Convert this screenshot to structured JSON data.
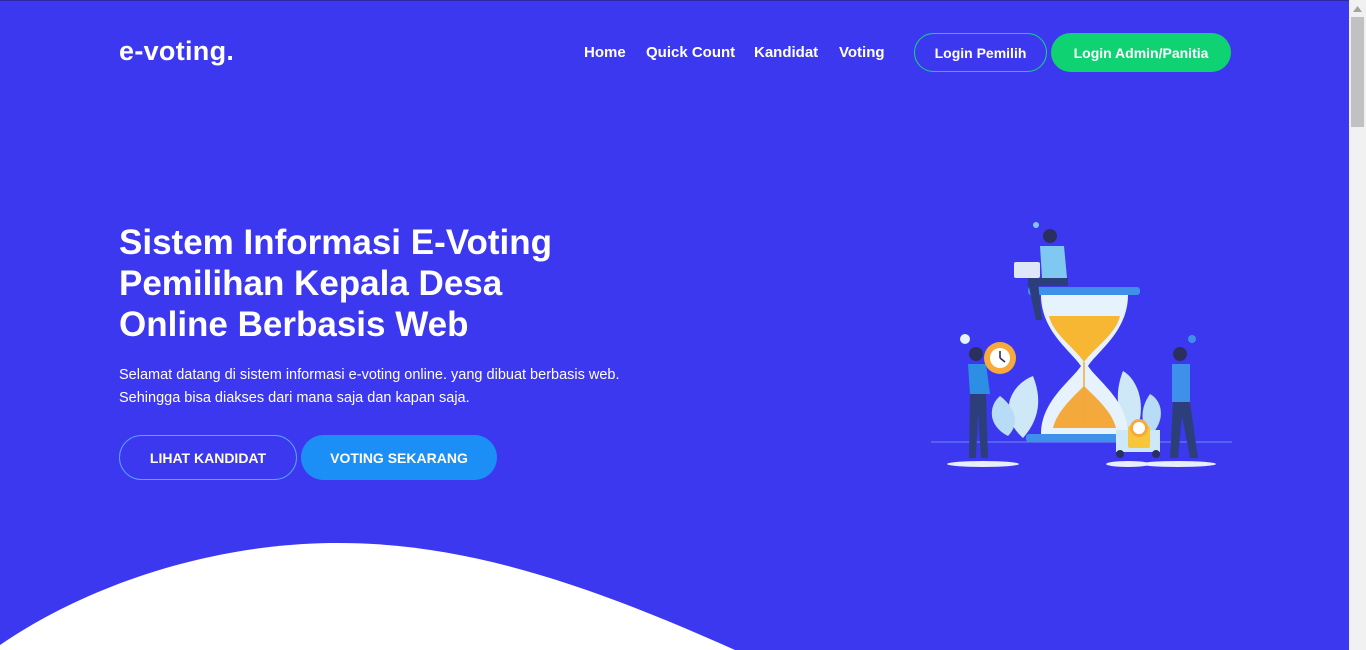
{
  "brand": {
    "logo_text": "e-voting."
  },
  "nav": {
    "links": [
      {
        "label": "Home"
      },
      {
        "label": "Quick Count"
      },
      {
        "label": "Kandidat"
      },
      {
        "label": "Voting"
      }
    ],
    "login_voter_label": "Login Pemilih",
    "login_admin_label": "Login Admin/Panitia"
  },
  "hero": {
    "title_lines": [
      "Sistem Informasi E-Voting",
      "Pemilihan Kepala Desa",
      "Online Berbasis Web"
    ],
    "subtitle_lines": [
      "Selamat datang di sistem informasi e-voting online. yang dibuat berbasis web.",
      "Sehingga bisa diakses dari mana saja dan kapan saja."
    ],
    "btn_view_candidates": "LIHAT KANDIDAT",
    "btn_vote_now": "VOTING SEKARANG"
  },
  "colors": {
    "hero_bg": "#3c38f0",
    "accent_green": "#0fd372",
    "accent_blue": "#1c8ff6",
    "text": "#ffffff"
  },
  "illustration": {
    "icon": "hourglass-people-illustration"
  }
}
